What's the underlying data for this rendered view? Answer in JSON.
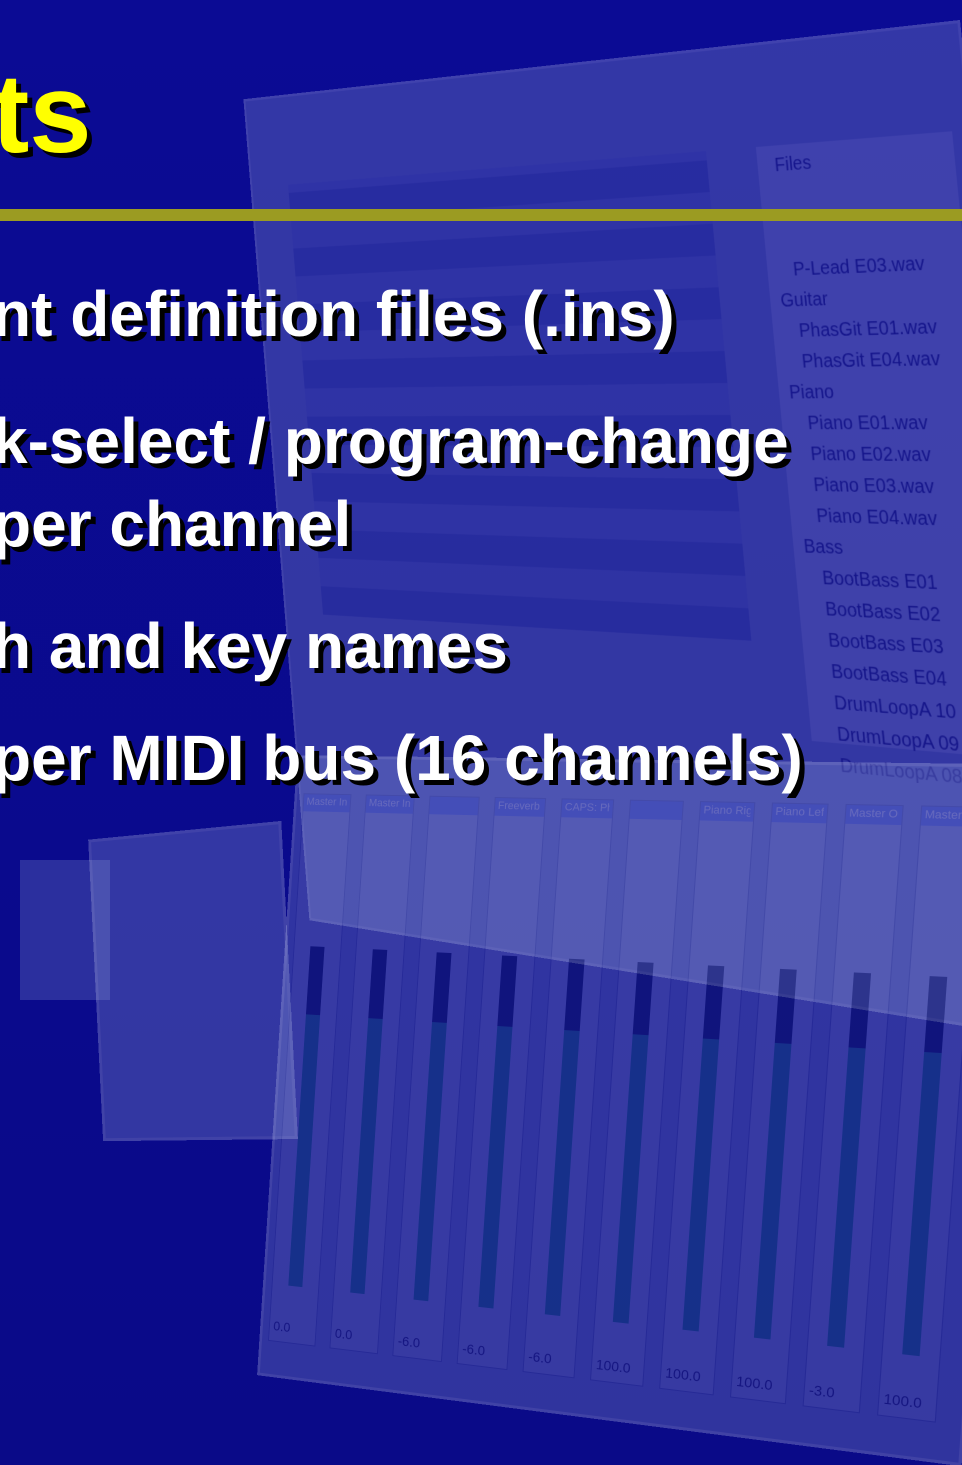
{
  "slide": {
    "title": "ts",
    "bullets": [
      "nt definition files (.ins)",
      "k-select / program-change",
      "per channel",
      "h and key names",
      "per MIDI bus (16 channels)"
    ]
  },
  "background": {
    "files_panel": {
      "title": "Files",
      "items": [
        "P-Lead E03.wav",
        "Guitar",
        "PhasGit E01.wav",
        "PhasGit E04.wav",
        "Piano",
        "Piano E01.wav",
        "Piano E02.wav",
        "Piano E03.wav",
        "Piano E04.wav",
        "Bass",
        "BootBass E01",
        "BootBass E02",
        "BootBass E03",
        "BootBass E04",
        "DrumLoopA 10",
        "DrumLoopA 09",
        "DrumLoopA 08"
      ]
    },
    "mixer_strips": [
      {
        "name": "Master In",
        "value": "0.0"
      },
      {
        "name": "Master In",
        "value": "0.0"
      },
      {
        "name": "",
        "value": "-6.0"
      },
      {
        "name": "Freeverb",
        "value": "-6.0"
      },
      {
        "name": "CAPS: Ph",
        "value": "-6.0"
      },
      {
        "name": "",
        "value": "100.0"
      },
      {
        "name": "Piano Right",
        "value": "100.0"
      },
      {
        "name": "Piano Left",
        "value": "100.0"
      },
      {
        "name": "Master Out",
        "value": "-3.0"
      },
      {
        "name": "Master Out",
        "value": "100.0"
      }
    ],
    "colors": {
      "background": "#0a0a8c",
      "title": "#ffff00",
      "rule": "#9b9b22",
      "text": "#ffffff"
    }
  }
}
